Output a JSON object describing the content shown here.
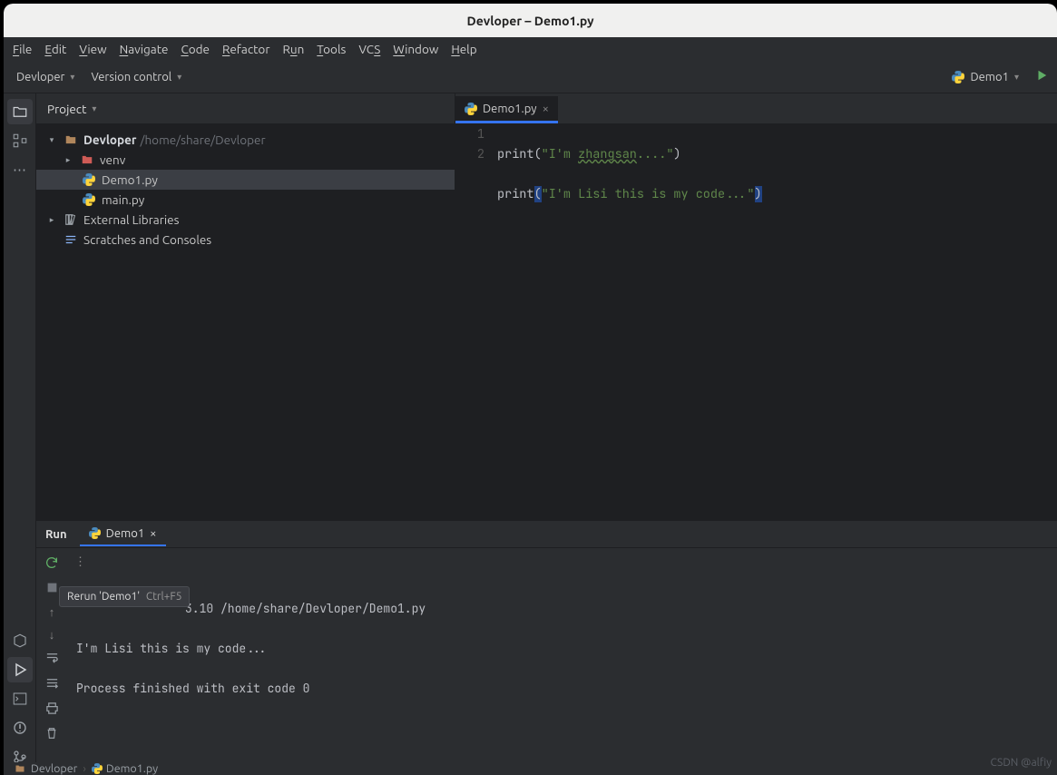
{
  "titlebar": {
    "text": "Devloper – Demo1.py"
  },
  "menu": {
    "items": [
      "File",
      "Edit",
      "View",
      "Navigate",
      "Code",
      "Refactor",
      "Run",
      "Tools",
      "VCS",
      "Window",
      "Help"
    ]
  },
  "toolbar": {
    "project_dd": "Devloper",
    "version_ctrl": "Version control",
    "run_config": "Demo1"
  },
  "project": {
    "title": "Project",
    "root": {
      "name": "Devloper",
      "path": "/home/share/Devloper"
    },
    "venv": "venv",
    "file_selected": "Demo1.py",
    "file_main": "main.py",
    "ext_lib": "External Libraries",
    "scratches": "Scratches and Consoles"
  },
  "editor": {
    "tab_name": "Demo1.py",
    "line1_num": "1",
    "line2_num": "2",
    "code": {
      "l1_fn": "print",
      "l1_str_a": "\"I'm ",
      "l1_str_mid": "zhangsan",
      "l1_str_b": "....\"",
      "l2_fn": "print",
      "l2_str": "\"I'm Lisi this is my code...\""
    }
  },
  "run": {
    "title": "Run",
    "tab": "Demo1",
    "tooltip_label": "Rerun 'Demo1'",
    "tooltip_shortcut": "Ctrl+F5",
    "console": {
      "l1": "3.10 /home/share/Devloper/Demo1.py",
      "l2": "I'm Lisi this is my code...",
      "l3": "Process finished with exit code 0"
    }
  },
  "breadcrumb": {
    "project": "Devloper",
    "file": "Demo1.py"
  },
  "watermark": {
    "l1": "CSDN @alfiy",
    "l2": ""
  }
}
